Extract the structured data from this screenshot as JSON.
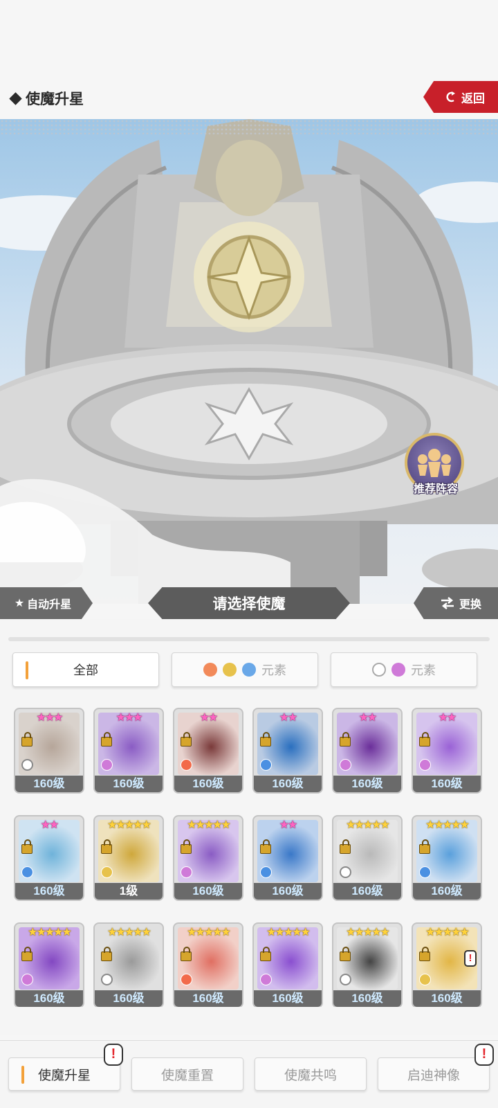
{
  "header": {
    "title": "使魔升星",
    "back_label": "返回"
  },
  "stage": {
    "recommend_label": "推荐阵容"
  },
  "actions": {
    "auto_star": "自动升星",
    "select_prompt": "请选择使魔",
    "change": "更换"
  },
  "filters": [
    {
      "label": "全部",
      "active": true
    },
    {
      "label": "元素",
      "active": false,
      "icons": [
        "fire-icon",
        "wind-icon",
        "water-icon"
      ]
    },
    {
      "label": "元素",
      "active": false,
      "icons": [
        "light-icon",
        "dark-icon"
      ]
    }
  ],
  "cards": [
    {
      "level": "160级",
      "stars": "★★★",
      "star_color": "pink",
      "element": "light",
      "bg": "#d9d2cc",
      "accent": "#b6a69a"
    },
    {
      "level": "160级",
      "stars": "★★★",
      "star_color": "pink",
      "element": "dark",
      "bg": "#cbb7e6",
      "accent": "#8a5cc4"
    },
    {
      "level": "160级",
      "stars": "★★",
      "star_color": "pink",
      "element": "fire",
      "bg": "#e8d3cf",
      "accent": "#7a3a3a"
    },
    {
      "level": "160级",
      "stars": "★★",
      "star_color": "pink",
      "element": "water",
      "bg": "#b9cbe3",
      "accent": "#2a6fbf"
    },
    {
      "level": "160级",
      "stars": "★★",
      "star_color": "pink",
      "element": "dark",
      "bg": "#cbb7e6",
      "accent": "#6b2f9a"
    },
    {
      "level": "160级",
      "stars": "★★",
      "star_color": "pink",
      "element": "dark",
      "bg": "#d6c4ee",
      "accent": "#9a62d6"
    },
    {
      "level": "160级",
      "stars": "★★",
      "star_color": "pink",
      "element": "water",
      "bg": "#cfe3f2",
      "accent": "#6fb3da"
    },
    {
      "level": "1级",
      "stars": "★★★★★",
      "star_color": "gold",
      "element": "wind",
      "bg": "#efe2bd",
      "accent": "#cfa83c",
      "level_white": true
    },
    {
      "level": "160级",
      "stars": "★★★★★",
      "star_color": "gold",
      "element": "dark",
      "bg": "#d8c6ee",
      "accent": "#8a5cc4"
    },
    {
      "level": "160级",
      "stars": "★★",
      "star_color": "pink",
      "element": "water",
      "bg": "#bcd2ee",
      "accent": "#3a78c8"
    },
    {
      "level": "160级",
      "stars": "★★★★★",
      "star_color": "gold",
      "element": "light",
      "bg": "#e6e6e6",
      "accent": "#b9b9b9"
    },
    {
      "level": "160级",
      "stars": "★★★★★",
      "star_color": "gold",
      "element": "water",
      "bg": "#cfe0f2",
      "accent": "#5aa0dc"
    },
    {
      "level": "160级",
      "stars": "★★★★★",
      "star_color": "gold",
      "element": "dark",
      "bg": "#c9a8e8",
      "accent": "#8348c2"
    },
    {
      "level": "160级",
      "stars": "★★★★★",
      "star_color": "gold",
      "element": "light",
      "bg": "#e0e0e0",
      "accent": "#9a9a9a"
    },
    {
      "level": "160级",
      "stars": "★★★★★",
      "star_color": "gold",
      "element": "fire",
      "bg": "#f2d0c8",
      "accent": "#e06f62"
    },
    {
      "level": "160级",
      "stars": "★★★★★",
      "star_color": "gold",
      "element": "dark",
      "bg": "#d2bdee",
      "accent": "#8a4fd0"
    },
    {
      "level": "160级",
      "stars": "★★★★★",
      "star_color": "gold",
      "element": "light",
      "bg": "#e6e6e6",
      "accent": "#444444"
    },
    {
      "level": "160级",
      "stars": "★★★★★",
      "star_color": "gold",
      "element": "wind",
      "bg": "#f3e3b8",
      "accent": "#e2b646",
      "alert": "!"
    }
  ],
  "bottom_tabs": [
    {
      "label": "使魔升星",
      "active": true,
      "badge": "!"
    },
    {
      "label": "使魔重置",
      "active": false
    },
    {
      "label": "使魔共鸣",
      "active": false
    },
    {
      "label": "启迪神像",
      "active": false,
      "badge": "!"
    }
  ],
  "colors": {
    "accent_red": "#c8202a",
    "tab_indicator": "#f3a13a",
    "level_bar": "#6a6a6a"
  }
}
